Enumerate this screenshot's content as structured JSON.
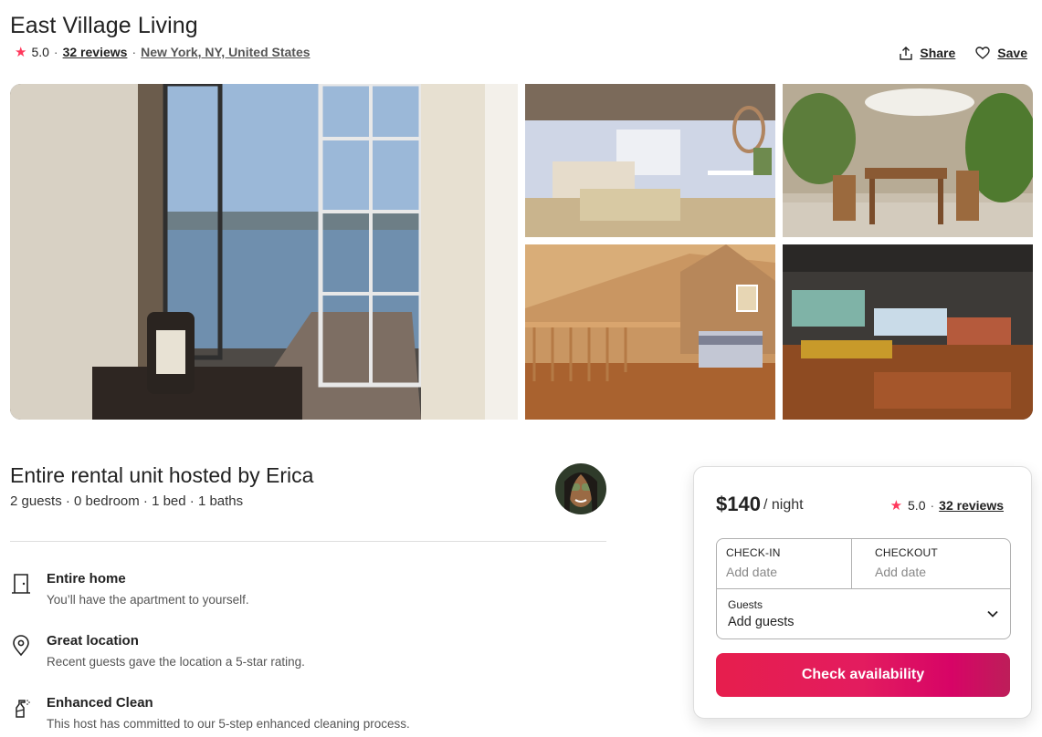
{
  "listing": {
    "title": "East Village Living",
    "rating": "5.0",
    "reviews": "32 reviews",
    "location": "New York, NY, United States",
    "separator": "·"
  },
  "actions": {
    "share": "Share",
    "save": "Save"
  },
  "host": {
    "title": "Entire rental unit hosted by Erica",
    "summary": "2 guests · 0 bedroom · 1 bed · 1 baths"
  },
  "features": [
    {
      "name": "Entire home",
      "desc": "You’ll have the apartment to yourself.",
      "icon": "door-icon"
    },
    {
      "name": "Great location",
      "desc": "Recent guests gave the location a 5-star rating.",
      "icon": "location-pin-icon"
    },
    {
      "name": "Enhanced Clean",
      "desc": "This host has committed to our 5-step enhanced cleaning process.",
      "icon": "spray-bottle-icon"
    }
  ],
  "booking": {
    "price": "$140",
    "per_night": "/ night",
    "rating": "5.0",
    "reviews": "32 reviews",
    "checkin_label": "CHECK-IN",
    "checkin_placeholder": "Add date",
    "checkout_label": "CHECKOUT",
    "checkout_placeholder": "Add date",
    "guests_label": "Guests",
    "guests_value": "Add guests",
    "cta": "Check availability"
  },
  "colors": {
    "brand": "#ff385c",
    "cta_start": "#e61e4d",
    "cta_end": "#bd1e59",
    "border": "#dddddd"
  }
}
